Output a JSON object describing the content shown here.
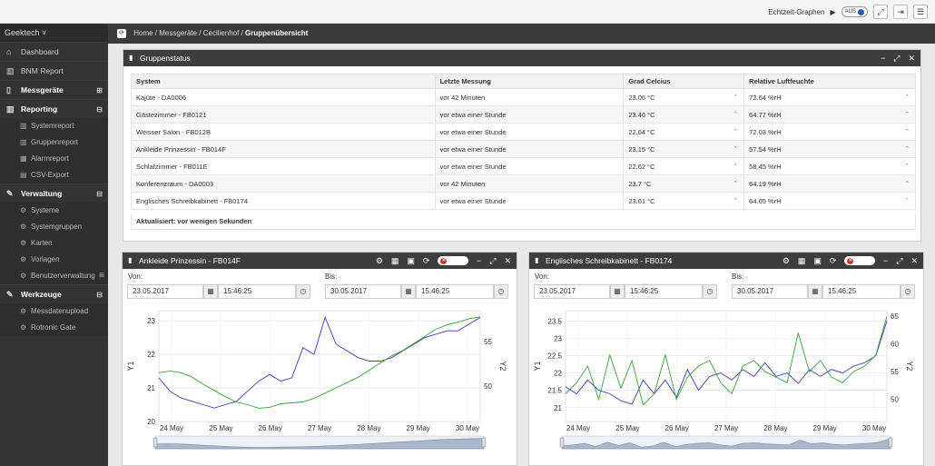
{
  "topbar": {
    "label": "Echtzeit-Graphen",
    "toggle": "AUS"
  },
  "sidebar": {
    "brand": "Geektech",
    "items": [
      {
        "label": "Dashboard",
        "icon": "home-icon"
      },
      {
        "label": "BNM Report",
        "icon": "chart-icon"
      },
      {
        "label": "Messgeräte",
        "icon": "device-icon",
        "bold": true,
        "expand": "⊞"
      },
      {
        "label": "Reporting",
        "icon": "chart-icon",
        "bold": true,
        "expand": "⊟"
      }
    ],
    "reporting": [
      "Systemreport",
      "Gruppenreport",
      "Alarmreport",
      "CSV-Export"
    ],
    "verwaltung": {
      "label": "Verwaltung",
      "expand": "⊟",
      "items": [
        "Systeme",
        "Systemgruppen",
        "Karten",
        "Vorlagen",
        "Benutzerverwaltung"
      ]
    },
    "werkzeuge": {
      "label": "Werkzeuge",
      "expand": "⊟",
      "items": [
        "Messdatenupload",
        "Rotronic Gate"
      ]
    }
  },
  "breadcrumb": {
    "items": [
      "Home /",
      "Messgeräte /",
      "Cecilienhof /"
    ],
    "current": "Gruppenübersicht"
  },
  "gruppenstatus": {
    "title": "Gruppenstatus",
    "headers": [
      "System",
      "Letzte Messung",
      "Grad Celcius",
      "Relative Luftfeuchte"
    ],
    "rows": [
      [
        "Kajüte - DA0006",
        "vor 42 Minuten",
        "23.06 °C",
        "72.64 %rH"
      ],
      [
        "Gästezimmer - FB0121",
        "vor etwa einer Stunde",
        "23.46 °C",
        "64.77 %rH"
      ],
      [
        "Weisser Salon - FB012B",
        "vor etwa einer Stunde",
        "22.64 °C",
        "72.03 %rH"
      ],
      [
        "Ankleide Prinzessin - FB014F",
        "vor etwa einer Stunde",
        "23.15 °C",
        "57.54 %rH"
      ],
      [
        "Schlafzimmer - FB011E",
        "vor etwa einer Stunde",
        "22.62 °C",
        "58.45 %rH"
      ],
      [
        "Konferenzraum - DA0003",
        "vor 42 Minuten",
        "23.7 °C",
        "64.19 %rH"
      ],
      [
        "Englisches Schreibkabinett - FB0174",
        "vor etwa einer Stunde",
        "23.61 °C",
        "64.65 %rH"
      ]
    ],
    "updated": "Aktualisiert: vor wenigen Sekunden"
  },
  "charts": [
    {
      "title": "Ankleide Prinzessin - FB014F",
      "von_label": "Von:",
      "bis_label": "Bis:",
      "von_date": "23.05.2017",
      "von_time": "15:46:25",
      "bis_date": "30.05.2017",
      "bis_time": "15:46:25",
      "toggle": "AUS"
    },
    {
      "title": "Englisches Schreibkabinett - FB0174",
      "von_label": "Von:",
      "bis_label": "Bis:",
      "von_date": "23.05.2017",
      "von_time": "15:46:25",
      "bis_date": "30.05.2017",
      "bis_time": "15:46:25",
      "toggle": "AUS"
    }
  ],
  "chart_data": [
    {
      "type": "line",
      "xlabels": [
        "24 May",
        "25 May",
        "26 May",
        "27 May",
        "28 May",
        "29 May",
        "30 May"
      ],
      "ylabel": "Y1",
      "y2label": "Y2",
      "y1ticks": [
        20,
        21,
        22,
        23
      ],
      "y2ticks": [
        50,
        55
      ],
      "series": [
        {
          "color": "#3b3bb3",
          "axis": "y1",
          "values": [
            21.3,
            20.9,
            20.7,
            20.6,
            20.5,
            20.4,
            20.5,
            20.6,
            20.9,
            21.2,
            21.4,
            21.2,
            21.3,
            22.2,
            22.0,
            23.1,
            22.3,
            22.1,
            21.9,
            21.8,
            21.8,
            21.9,
            22.1,
            22.3,
            22.5,
            22.6,
            22.7,
            22.7,
            22.9,
            23.1
          ]
        },
        {
          "color": "#3aa03a",
          "axis": "y2",
          "values": [
            51.5,
            51.7,
            51.5,
            51.0,
            50.2,
            49.5,
            48.8,
            48.2,
            47.9,
            47.5,
            47.6,
            48.0,
            48.1,
            48.2,
            48.6,
            49.2,
            49.8,
            50.4,
            51.0,
            51.8,
            52.6,
            53.4,
            54.0,
            54.8,
            55.6,
            56.4,
            56.9,
            57.2,
            57.6,
            57.8
          ]
        }
      ]
    },
    {
      "type": "line",
      "xlabels": [
        "24 May",
        "25 May",
        "26 May",
        "27 May",
        "28 May",
        "29 May",
        "30 May"
      ],
      "ylabel": "Y1",
      "y2label": "Y2",
      "y1ticks": [
        21,
        21.5,
        22,
        22.5,
        23,
        23.5
      ],
      "y2ticks": [
        50,
        55,
        60,
        65
      ],
      "series": [
        {
          "color": "#3b3bb3",
          "axis": "y1",
          "values": [
            21.6,
            21.4,
            21.8,
            21.5,
            21.4,
            21.2,
            21.1,
            21.8,
            21.4,
            21.8,
            21.3,
            22.1,
            21.5,
            21.9,
            22.0,
            21.8,
            22.1,
            21.9,
            22.3,
            21.9,
            22.0,
            21.7,
            22.1,
            21.9,
            22.1,
            22.0,
            22.2,
            22.3,
            22.5,
            23.5
          ]
        },
        {
          "color": "#3aa03a",
          "axis": "y2",
          "values": [
            51,
            53,
            56,
            50,
            58,
            52,
            57,
            49,
            51,
            58,
            50,
            54,
            56,
            57,
            53,
            51,
            56,
            57,
            55,
            54,
            53,
            62,
            55,
            57,
            54,
            53,
            55,
            56,
            58,
            65
          ]
        }
      ]
    }
  ]
}
